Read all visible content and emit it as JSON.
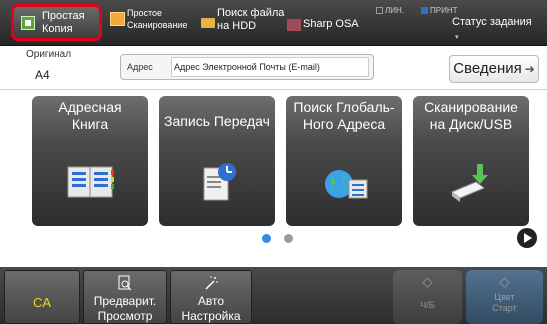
{
  "topbar": {
    "simple_copy": [
      "Простая",
      "Копия"
    ],
    "simple_scan": [
      "Простое",
      "Сканирование"
    ],
    "hdd_search": [
      "Поиск файла",
      "на HDD"
    ],
    "osa": "Sharp OSA",
    "lin": "ЛИН.",
    "print": "ПРИНТ",
    "job_status": "Статус задания"
  },
  "original": {
    "label": "Оригинал",
    "value": "A4"
  },
  "address": {
    "label": "Адрес",
    "value": "Адрес Электронной Почты (E-mail)"
  },
  "details_button": "Сведения",
  "tiles": [
    {
      "label": [
        "Адресная",
        "Книга"
      ],
      "icon": "address-book-icon"
    },
    {
      "label": [
        "Запись Передач"
      ],
      "icon": "transmission-log-icon"
    },
    {
      "label": [
        "Поиск Глобаль-",
        "Ного Адреса"
      ],
      "icon": "global-address-search-icon"
    },
    {
      "label": [
        "Сканирование",
        "на Диск/USB"
      ],
      "icon": "scan-to-usb-icon"
    }
  ],
  "pager": {
    "current": 1,
    "total": 2
  },
  "bottom": {
    "ca": "CA",
    "preview": [
      "Предварит.",
      "Просмотр"
    ],
    "auto": [
      "Авто",
      "Настройка"
    ],
    "bw_start": "Ч/Б",
    "color_start": [
      "Цвет",
      "Старт"
    ]
  },
  "colors": {
    "accent_blue": "#2e8fe0",
    "ca_yellow": "#f6d40e",
    "highlight_red": "#e3001b"
  }
}
